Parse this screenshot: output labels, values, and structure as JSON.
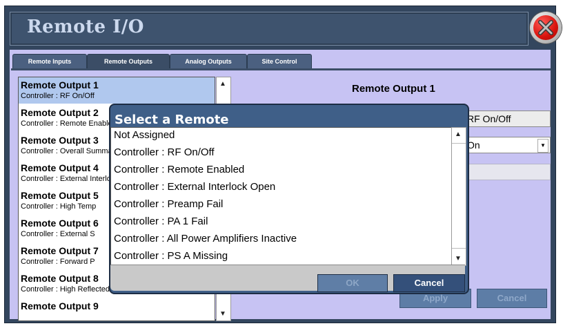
{
  "window": {
    "title": "Remote I/O"
  },
  "tabs": [
    {
      "label": "Remote Inputs",
      "active": false
    },
    {
      "label": "Remote Outputs",
      "active": true
    },
    {
      "label": "Analog Outputs",
      "active": false
    },
    {
      "label": "Site Control",
      "active": false
    }
  ],
  "outputs_list": [
    {
      "title": "Remote Output 1",
      "subtitle": "Controller : RF On/Off",
      "selected": true
    },
    {
      "title": "Remote Output 2",
      "subtitle": "Controller : Remote Enabled",
      "selected": false
    },
    {
      "title": "Remote Output 3",
      "subtitle": "Controller : Overall Summary",
      "selected": false
    },
    {
      "title": "Remote Output 4",
      "subtitle": "Controller : External Interlock",
      "selected": false
    },
    {
      "title": "Remote Output 5",
      "subtitle": "Controller : High Temp",
      "selected": false
    },
    {
      "title": "Remote Output 6",
      "subtitle": "Controller : External S",
      "selected": false
    },
    {
      "title": "Remote Output 7",
      "subtitle": "Controller : Forward P",
      "selected": false
    },
    {
      "title": "Remote Output 8",
      "subtitle": "Controller : High Reflected Summary",
      "selected": false
    },
    {
      "title": "Remote Output 9",
      "subtitle": "",
      "selected": false
    }
  ],
  "detail": {
    "title": "Remote Output 1",
    "remote_field": "RF On/Off",
    "mode_select": "On",
    "apply_label": "Apply",
    "cancel_label": "Cancel"
  },
  "dialog": {
    "title": "Select a Remote",
    "options": [
      "Not Assigned",
      "Controller : RF On/Off",
      "Controller : Remote Enabled",
      "Controller : External Interlock Open",
      "Controller : Preamp Fail",
      "Controller : PA 1 Fail",
      "Controller : All Power Amplifiers Inactive",
      "Controller : PS A Missing"
    ],
    "ok_label": "OK",
    "cancel_label": "Cancel"
  },
  "colors": {
    "frame": "#33465e",
    "content_bg": "#c7c3f3",
    "close_button": "#d8130d",
    "dialog": "#3f5f88"
  },
  "icons": {
    "close": "close-x-icon",
    "scroll_up": "arrow-up-icon",
    "scroll_down": "arrow-down-icon"
  }
}
